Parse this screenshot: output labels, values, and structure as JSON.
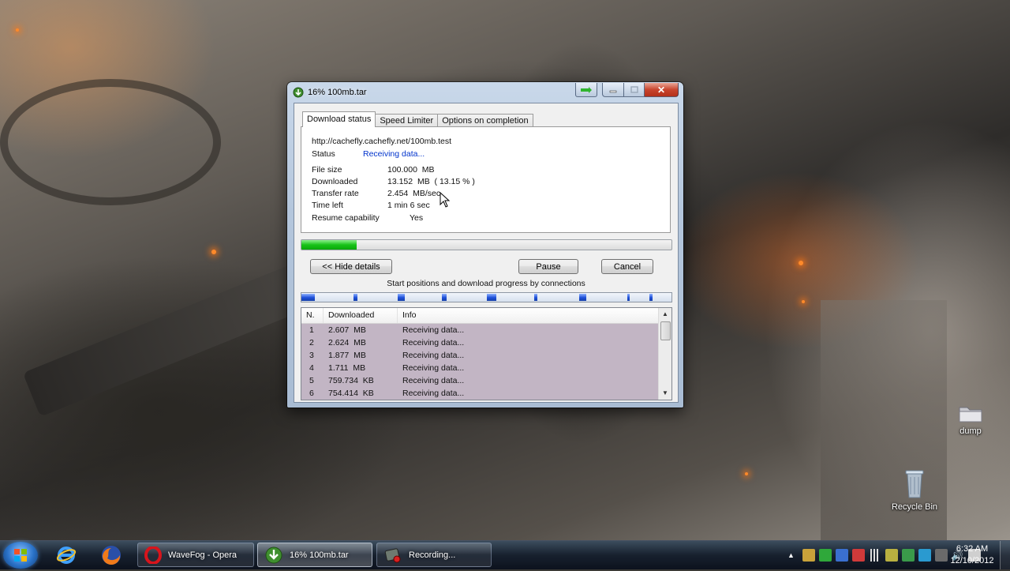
{
  "window": {
    "title": "16% 100mb.tar",
    "tabs": [
      {
        "label": "Download status",
        "active": true
      },
      {
        "label": "Speed Limiter",
        "active": false
      },
      {
        "label": "Options on completion",
        "active": false
      }
    ],
    "status": {
      "url": "http://cachefly.cachefly.net/100mb.test",
      "status_label": "Status",
      "status_value": "Receiving data...",
      "file_size_label": "File size",
      "file_size_value": "100.000  MB",
      "downloaded_label": "Downloaded",
      "downloaded_value": "13.152  MB  ( 13.15 % )",
      "transfer_rate_label": "Transfer rate",
      "transfer_rate_value": "2.454  MB/sec",
      "time_left_label": "Time left",
      "time_left_value": "1 min 6 sec",
      "resume_label": "Resume capability",
      "resume_value": "Yes"
    },
    "progress_percent": 15,
    "buttons": {
      "hide_details": "<< Hide details",
      "pause": "Pause",
      "cancel": "Cancel"
    },
    "connections_caption": "Start positions and download progress by connections",
    "connection_segments_percent": [
      0,
      14,
      26,
      38,
      50,
      63,
      75,
      88,
      94
    ],
    "list": {
      "columns": [
        "N.",
        "Downloaded",
        "Info"
      ],
      "rows": [
        {
          "n": "1",
          "downloaded": "2.607  MB",
          "info": "Receiving data..."
        },
        {
          "n": "2",
          "downloaded": "2.624  MB",
          "info": "Receiving data..."
        },
        {
          "n": "3",
          "downloaded": "1.877  MB",
          "info": "Receiving data..."
        },
        {
          "n": "4",
          "downloaded": "1.711  MB",
          "info": "Receiving data..."
        },
        {
          "n": "5",
          "downloaded": "759.734  KB",
          "info": "Receiving data..."
        },
        {
          "n": "6",
          "downloaded": "754.414  KB",
          "info": "Receiving data..."
        }
      ]
    }
  },
  "desktop_icons": [
    {
      "label": "dump",
      "icon": "folder-icon"
    },
    {
      "label": "Recycle Bin",
      "icon": "recycle-bin-icon"
    }
  ],
  "taskbar": {
    "pinned": [
      "internet-explorer-icon",
      "firefox-icon"
    ],
    "tasks": [
      {
        "label": "WaveFog - Opera",
        "icon": "opera-icon",
        "active": false
      },
      {
        "label": "16% 100mb.tar",
        "icon": "idm-icon",
        "active": true
      },
      {
        "label": "Recording...",
        "icon": "recorder-icon",
        "active": false
      }
    ],
    "clock_time": "6:32 AM",
    "clock_date": "12/10/2012"
  },
  "colors": {
    "progress_green": "#18c318",
    "segment_blue": "#1d4fd8",
    "status_blue": "#0033cc",
    "list_row_bg": "#c2b5c4"
  }
}
